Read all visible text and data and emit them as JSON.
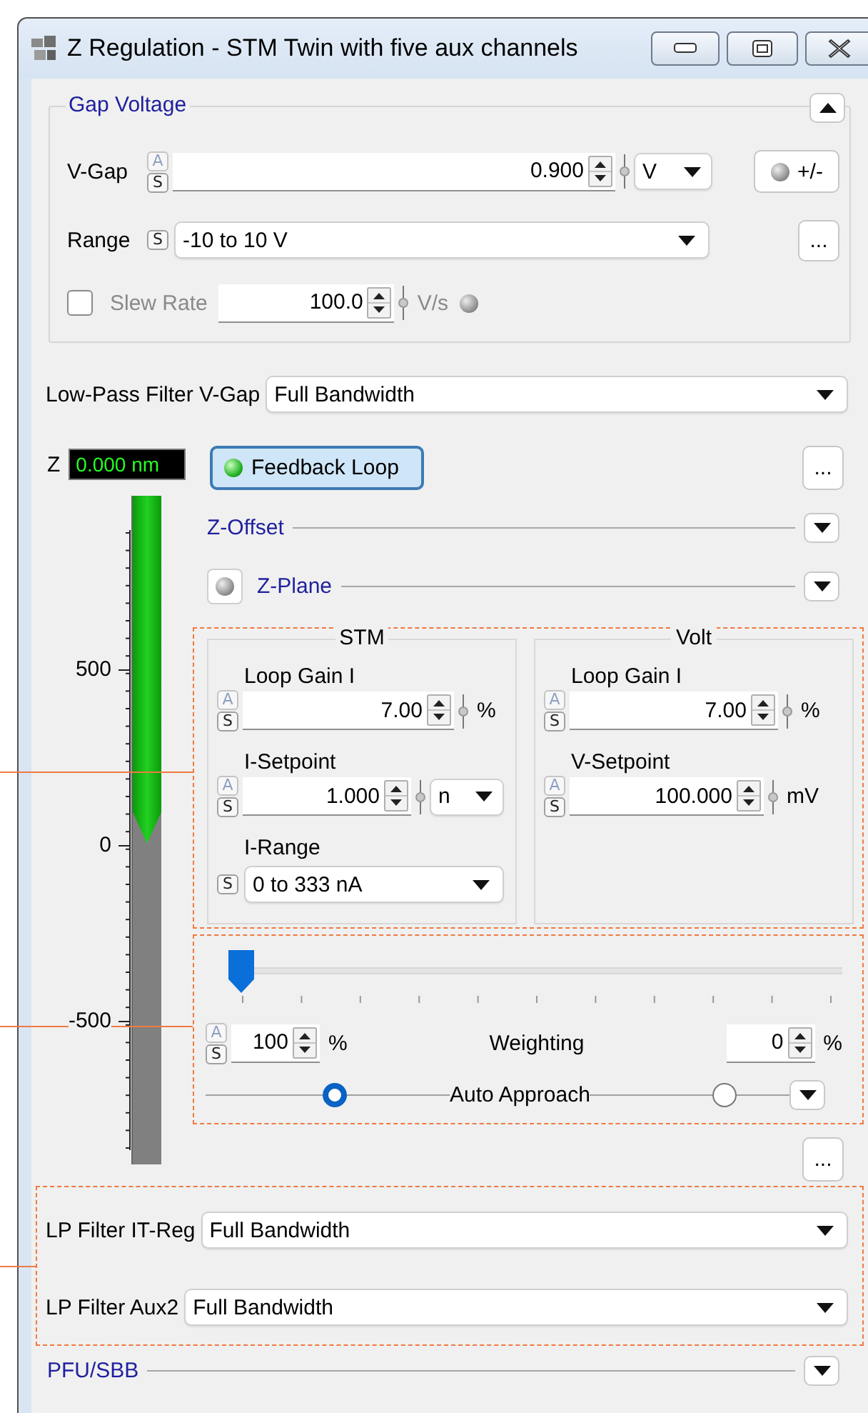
{
  "window": {
    "title": "Z Regulation - STM Twin with five aux channels"
  },
  "gap_voltage": {
    "title": "Gap Voltage",
    "expanded": true,
    "v_gap": {
      "label": "V-Gap",
      "badges": [
        "A",
        "S"
      ],
      "value": "0.900",
      "unit": {
        "kind": "dropdown",
        "text": "V"
      },
      "polarity_button": "+/-"
    },
    "range": {
      "label": "Range",
      "badges": [
        "S"
      ],
      "value": "-10 to 10 V",
      "more_button": "..."
    },
    "slew_rate": {
      "label": "Slew Rate",
      "checked": false,
      "value": "100.0",
      "unit": {
        "kind": "text",
        "text": "V/s"
      }
    }
  },
  "low_pass_filter": {
    "label": "Low-Pass Filter V-Gap",
    "value": "Full Bandwidth"
  },
  "z_meter": {
    "label": "Z",
    "reading": "0.000 nm",
    "level": 0.52,
    "ticks": [
      "500",
      "0",
      "-500"
    ]
  },
  "feedback_loop": {
    "label": "Feedback Loop",
    "on": true,
    "more_button": "..."
  },
  "sections": [
    {
      "kind": "plain",
      "title": "Z-Offset",
      "expanded": false
    },
    {
      "kind": "led",
      "title": "Z-Plane",
      "expanded": false,
      "on": false
    }
  ],
  "controller_groups": [
    {
      "title": "STM",
      "fields": [
        {
          "kind": "spin",
          "label": "Loop Gain I",
          "badges": [
            "A",
            "S"
          ],
          "value": "7.00",
          "unit": {
            "kind": "text",
            "text": "%"
          }
        },
        {
          "kind": "spin",
          "label": "I-Setpoint",
          "badges": [
            "A",
            "S"
          ],
          "value": "1.000",
          "unit": {
            "kind": "dropdown",
            "text": "n"
          }
        },
        {
          "kind": "combo",
          "label": "I-Range",
          "badges": [
            "S"
          ],
          "value": "0 to 333 nA"
        }
      ]
    },
    {
      "title": "Volt",
      "fields": [
        {
          "kind": "spin",
          "label": "Loop Gain I",
          "badges": [
            "A",
            "S"
          ],
          "value": "7.00",
          "unit": {
            "kind": "text",
            "text": "%"
          }
        },
        {
          "kind": "spin",
          "label": "V-Setpoint",
          "badges": [
            "A",
            "S"
          ],
          "value": "100.000",
          "unit": {
            "kind": "text",
            "text": "mV"
          }
        }
      ]
    }
  ],
  "weighting": {
    "level": 0,
    "label": "Weighting",
    "left": {
      "badges": [
        "A",
        "S"
      ],
      "value": "100",
      "unit": {
        "kind": "text",
        "text": "%"
      }
    },
    "right": {
      "value": "0",
      "unit": {
        "kind": "text",
        "text": "%"
      }
    }
  },
  "auto_approach": {
    "label": "Auto Approach",
    "options": [
      {
        "selected": true
      },
      {
        "selected": false
      }
    ],
    "expanded": false
  },
  "more_button": "...",
  "lp_filters": [
    {
      "label": "LP Filter IT-Reg",
      "value": "Full Bandwidth"
    },
    {
      "label": "LP Filter Aux2",
      "value": "Full Bandwidth"
    }
  ],
  "pfu_sbb": {
    "title": "PFU/SBB",
    "expanded": false
  }
}
